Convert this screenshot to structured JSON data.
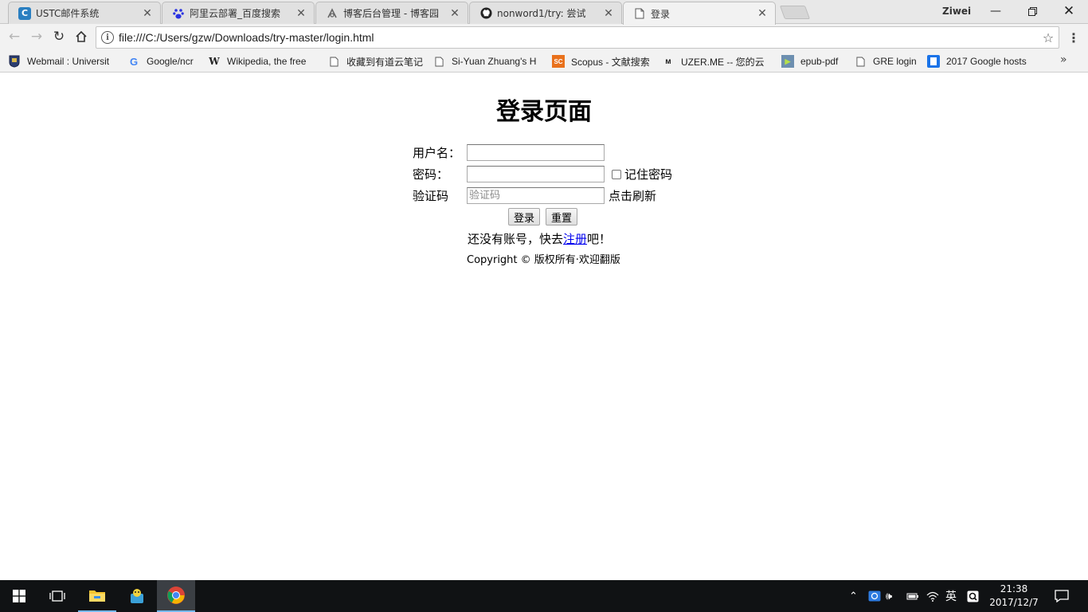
{
  "tabs": [
    {
      "title": "USTC邮件系统",
      "icon": "ustc-mail-icon",
      "active": false
    },
    {
      "title": "阿里云部署_百度搜索",
      "icon": "baidu-paw-icon",
      "active": false
    },
    {
      "title": "博客后台管理 - 博客园",
      "icon": "cnblogs-icon",
      "active": false
    },
    {
      "title": "nonword1/try: 尝试",
      "icon": "github-icon",
      "active": false
    },
    {
      "title": "登录",
      "icon": "page-icon",
      "active": true
    }
  ],
  "profile": {
    "name": "Ziwei"
  },
  "address_bar": {
    "url": "file:///C:/Users/gzw/Downloads/try-master/login.html"
  },
  "bookmarks": [
    {
      "label": "Webmail : Universit",
      "icon": "university-crest-icon"
    },
    {
      "label": "Google/ncr",
      "icon": "google-icon"
    },
    {
      "label": "Wikipedia, the free",
      "icon": "wikipedia-icon"
    },
    {
      "label": "收藏到有道云笔记",
      "icon": "page-icon"
    },
    {
      "label": "Si-Yuan Zhuang's H",
      "icon": "page-icon"
    },
    {
      "label": "Scopus - 文献搜索",
      "icon": "scopus-icon"
    },
    {
      "label": "UZER.ME -- 您的云",
      "icon": "uzer-icon"
    },
    {
      "label": "epub-pdf",
      "icon": "epub-icon"
    },
    {
      "label": "GRE login",
      "icon": "page-icon"
    },
    {
      "label": "2017 Google hosts",
      "icon": "bookmark-blue-icon"
    }
  ],
  "login": {
    "title": "登录页面",
    "username_label": "用户名：",
    "password_label": "密码：",
    "captcha_label": "验证码",
    "captcha_placeholder": "验证码",
    "remember_label": "记住密码",
    "refresh_label": "点击刷新",
    "login_button": "登录",
    "reset_button": "重置",
    "register_prefix": "还没有账号，快去",
    "register_link": "注册",
    "register_suffix": "吧！",
    "copyright": "Copyright © 版权所有·欢迎翻版"
  },
  "taskbar": {
    "time": "21:38",
    "date": "2017/12/7",
    "ime": "英"
  }
}
